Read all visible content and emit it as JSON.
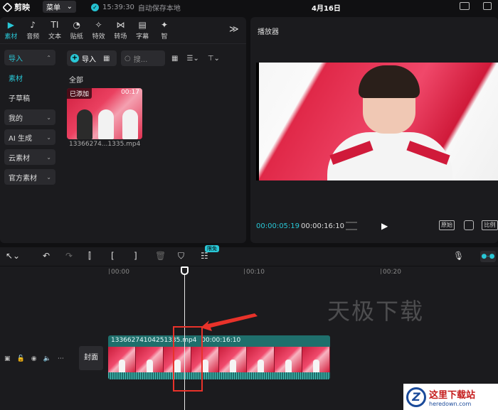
{
  "app": {
    "name": "剪映",
    "menu_label": "菜单",
    "save_time": "15:39:30",
    "save_text": "自动保存本地",
    "project_title": "4月16日"
  },
  "tabs": [
    {
      "label": "素材",
      "icon": "media-icon",
      "glyph": "▶",
      "active": true
    },
    {
      "label": "音频",
      "icon": "audio-icon",
      "glyph": "♪"
    },
    {
      "label": "文本",
      "icon": "text-icon",
      "glyph": "TI"
    },
    {
      "label": "贴纸",
      "icon": "sticker-icon",
      "glyph": "◔"
    },
    {
      "label": "特效",
      "icon": "effects-icon",
      "glyph": "✧"
    },
    {
      "label": "转场",
      "icon": "transition-icon",
      "glyph": "⋈"
    },
    {
      "label": "字幕",
      "icon": "subtitle-icon",
      "glyph": "▤"
    },
    {
      "label": "智",
      "icon": "smart-icon",
      "glyph": "✦"
    }
  ],
  "side_nav": [
    {
      "label": "导入",
      "style": "sel",
      "chevron": "^"
    },
    {
      "label": "素材",
      "style": "cy"
    },
    {
      "label": "子草稿",
      "style": "plain"
    },
    {
      "label": "我的",
      "style": "box",
      "chevron": "v"
    },
    {
      "label": "AI 生成",
      "style": "box",
      "chevron": "v"
    },
    {
      "label": "云素材",
      "style": "box",
      "chevron": "v"
    },
    {
      "label": "官方素材",
      "style": "box",
      "chevron": "v"
    }
  ],
  "media": {
    "import_label": "导入",
    "search_placeholder": "搜...",
    "section_all": "全部",
    "clip": {
      "badge": "已添加",
      "duration": "00:17",
      "filename": "13366274...1335.mp4"
    }
  },
  "player": {
    "title": "播放器",
    "timecode_current": "00:00:05:19",
    "timecode_total": "00:00:16:10",
    "original_label": "原始",
    "ratio_label": "比例"
  },
  "toolbar": {
    "free_badge": "限免"
  },
  "timeline": {
    "ticks": [
      "00:00",
      "00:10",
      "00:20"
    ],
    "watermark": "天极下载",
    "cover_label": "封面",
    "clip_label": "13366274104251335.mp4",
    "clip_duration": "00:00:16:10"
  },
  "site_logo": {
    "cn": "这里下载站",
    "en": "heredown.com",
    "letter": "Z"
  },
  "colors": {
    "accent": "#29c7d6",
    "highlight": "#e8322a",
    "clip_track": "#1f6f6c"
  }
}
